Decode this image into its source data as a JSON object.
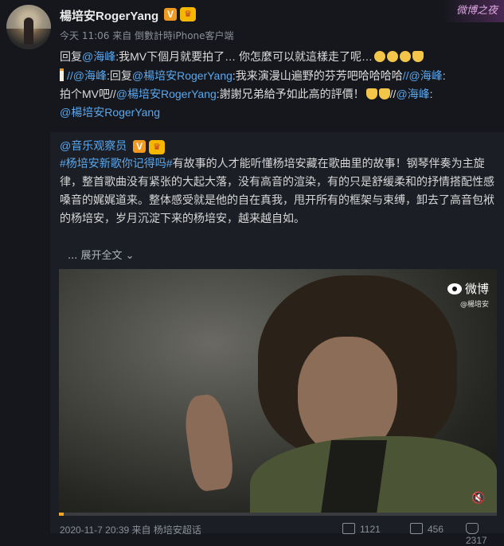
{
  "post": {
    "username": "楊培安RogerYang",
    "meta": "今天 11:06 来自 倒數計時iPhone客户端",
    "reply_line_1": {
      "prefix": "回复",
      "mention": "@海峰",
      "text": ":我MV下個月就要拍了… 你怎麼可以就這樣走了呢…"
    },
    "reply_line_2": {
      "m1": "//@海峰",
      "t1": ":回复",
      "m2": "@楊培安RogerYang",
      "t2": ":我来演漫山遍野的芬芳吧哈哈哈哈",
      "m3": "//@海峰",
      "t3": ":",
      "t4": "拍个MV吧//",
      "m4": "@楊培安RogerYang",
      "t5": ":謝謝兄弟給予如此高的評價！",
      "t6": "//",
      "m5": "@海峰",
      "t7": ":",
      "m6": "@楊培安RogerYang"
    },
    "watermark": "微博之夜"
  },
  "repost": {
    "author": "@音乐观察员",
    "hashtag": "#杨培安新歌你记得吗#",
    "text": "有故事的人才能听懂杨培安藏在歌曲里的故事！钢琴伴奏为主旋律，整首歌曲没有紧张的大起大落，没有高音的渲染，有的只是舒缓柔和的抒情搭配性感嗓音的娓娓道来。整体感受就是他的自在真我，甩开所有的框架与束缚，卸去了高音包袱的杨培安，岁月沉淀下来的杨培安，越来越自如。",
    "expand_label": "展开全文",
    "video": {
      "logo": "微博",
      "logo_sub": "@楊培安",
      "progress": 0.01
    },
    "footer": {
      "time_source": "2020-11-7 20:39 来自 杨培安超话",
      "reposts": "1121",
      "comments": "456",
      "likes": "2317"
    }
  },
  "colors": {
    "link": "#5aa8f0",
    "background": "#15171c",
    "repost_background": "#1b1e25"
  }
}
